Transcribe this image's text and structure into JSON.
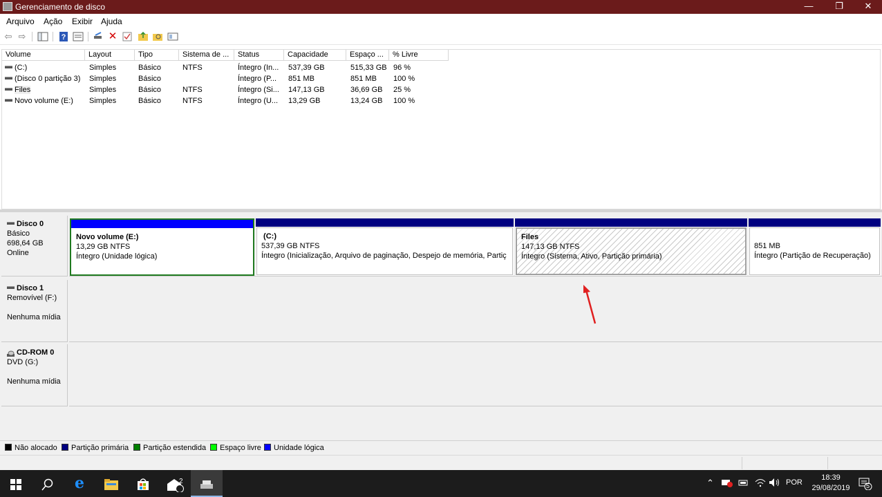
{
  "window": {
    "title": "Gerenciamento de disco",
    "minimize_glyph": "—",
    "restore_glyph": "❐",
    "close_glyph": "✕"
  },
  "menu": {
    "items": [
      "Arquivo",
      "Ação",
      "Exibir",
      "Ajuda"
    ]
  },
  "toolbar": {
    "icons": [
      "back-arrow-icon",
      "forward-arrow-icon",
      "console-tree-icon",
      "help-icon",
      "properties-icon",
      "connect-icon",
      "delete-icon",
      "check-icon",
      "new-folder-icon",
      "search-folder-icon",
      "view-icon"
    ]
  },
  "volume_table": {
    "columns": [
      "Volume",
      "Layout",
      "Tipo",
      "Sistema de ...",
      "Status",
      "Capacidade",
      "Espaço ...",
      "% Livre"
    ],
    "rows": [
      [
        "(C:)",
        "Simples",
        "Básico",
        "NTFS",
        "Íntegro (In...",
        "537,39 GB",
        "515,33 GB",
        "96 %"
      ],
      [
        "(Disco 0 partição 3)",
        "Simples",
        "Básico",
        "",
        "Íntegro (P...",
        "851 MB",
        "851 MB",
        "100 %"
      ],
      [
        "Files",
        "Simples",
        "Básico",
        "NTFS",
        "Íntegro (Si...",
        "147,13 GB",
        "36,69 GB",
        "25 %"
      ],
      [
        "Novo volume (E:)",
        "Simples",
        "Básico",
        "NTFS",
        "Íntegro (U...",
        "13,29 GB",
        "13,24 GB",
        "100 %"
      ]
    ]
  },
  "disks": [
    {
      "name": "Disco 0",
      "line1": "Básico",
      "line2": "698,64 GB",
      "line3": "Online",
      "partitions": [
        {
          "title": "Novo volume  (E:)",
          "size": "13,29 GB NTFS",
          "status": "Íntegro (Unidade lógica)",
          "bar_color": "#0000ff"
        },
        {
          "title": " (C:)",
          "size": "537,39 GB NTFS",
          "status": "Íntegro (Inicialização, Arquivo de paginação, Despejo de memória, Partiç",
          "bar_color": "#000080"
        },
        {
          "title": "Files",
          "size": "147,13 GB NTFS",
          "status": "Íntegro (Sistema, Ativo, Partição primária)",
          "bar_color": "#000080"
        },
        {
          "title": "",
          "size": "851 MB",
          "status": "Íntegro (Partição de Recuperação)",
          "bar_color": "#000080"
        }
      ]
    },
    {
      "name": "Disco 1",
      "line1": "Removível (F:)",
      "line2": "",
      "line3": "Nenhuma mídia"
    },
    {
      "name": "CD-ROM 0",
      "line1": "DVD (G:)",
      "line2": "",
      "line3": "Nenhuma mídia"
    }
  ],
  "legend": [
    {
      "label": "Não alocado",
      "color": "#000000"
    },
    {
      "label": "Partição primária",
      "color": "#000080"
    },
    {
      "label": "Partição estendida",
      "color": "#008000"
    },
    {
      "label": "Espaço livre",
      "color": "#00ff00"
    },
    {
      "label": "Unidade lógica",
      "color": "#0000ff"
    }
  ],
  "taskbar": {
    "language": "POR",
    "time": "18:39",
    "date": "29/08/2019",
    "mail_badge": "2",
    "notification_count": "5"
  }
}
